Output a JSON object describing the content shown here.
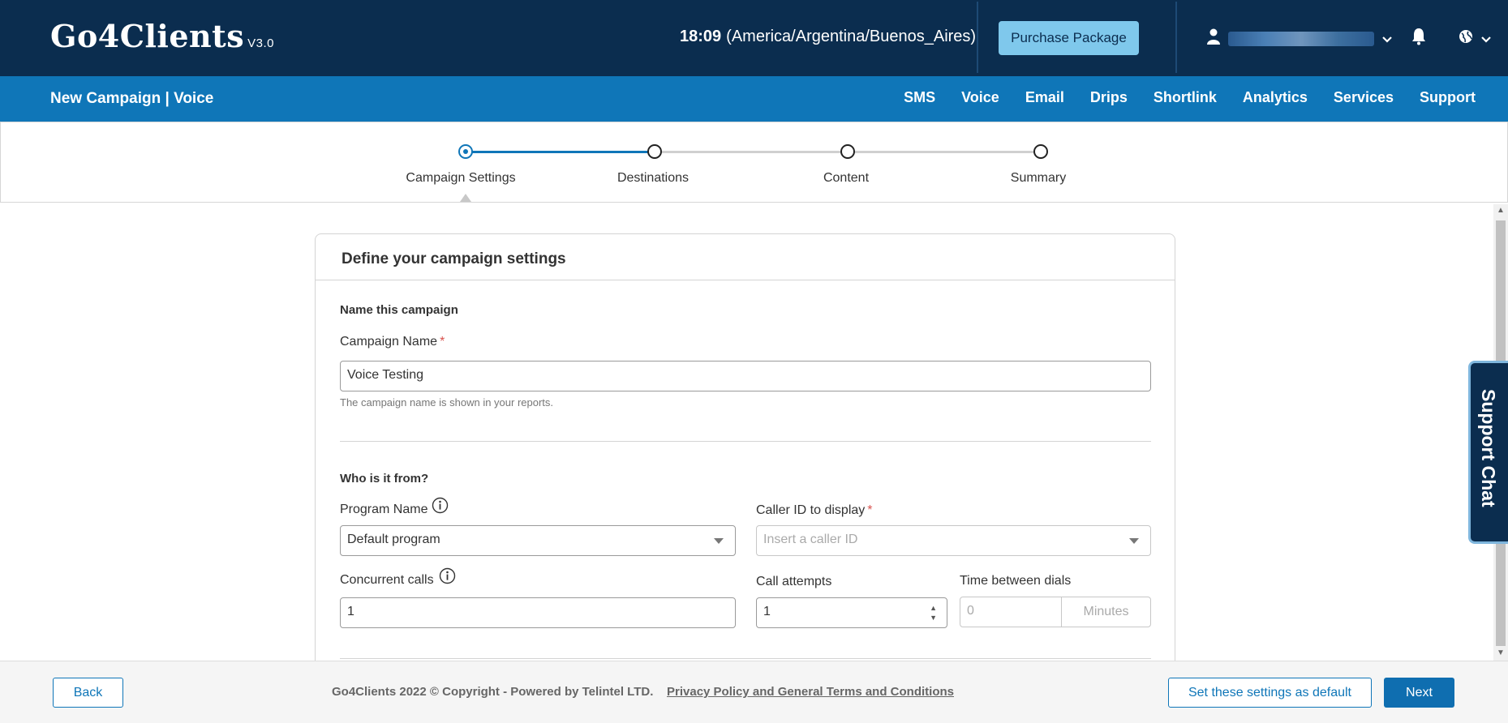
{
  "header": {
    "logo": "Go4Clients",
    "version": "V3.0",
    "time": "18:09",
    "timezone": "(America/Argentina/Buenos_Aires)",
    "purchase_label": "Purchase Package"
  },
  "nav": {
    "page_title": "New Campaign | Voice",
    "items": [
      {
        "label": "SMS"
      },
      {
        "label": "Voice"
      },
      {
        "label": "Email"
      },
      {
        "label": "Drips"
      },
      {
        "label": "Shortlink"
      },
      {
        "label": "Analytics"
      },
      {
        "label": "Services"
      },
      {
        "label": "Support"
      }
    ]
  },
  "stepper": {
    "steps": [
      {
        "label": "Campaign Settings",
        "active": true
      },
      {
        "label": "Destinations",
        "active": false
      },
      {
        "label": "Content",
        "active": false
      },
      {
        "label": "Summary",
        "active": false
      }
    ]
  },
  "form": {
    "card_title": "Define your campaign settings",
    "section_name": "Name this campaign",
    "campaign_name_label": "Campaign Name",
    "campaign_name_value": "Voice Testing",
    "campaign_name_hint": "The campaign name is shown in your reports.",
    "section_from": "Who is it from?",
    "program_name_label": "Program Name",
    "program_name_value": "Default program",
    "caller_id_label": "Caller ID to display",
    "caller_id_placeholder": "Insert a caller ID",
    "concurrent_calls_label": "Concurrent calls",
    "concurrent_calls_value": "1",
    "call_attempts_label": "Call attempts",
    "call_attempts_value": "1",
    "time_between_label": "Time between dials",
    "time_between_placeholder": "0",
    "time_between_unit": "Minutes",
    "required_mark": "*"
  },
  "support_chat": "Support Chat",
  "footer": {
    "back_label": "Back",
    "copyright": "Go4Clients 2022 © Copyright - Powered by Telintel LTD.",
    "policy_link": "Privacy Policy and General Terms and Conditions",
    "default_label": "Set these settings as default",
    "next_label": "Next"
  },
  "colors": {
    "header_bg": "#0b2d4f",
    "nav_bg": "#0f76b8",
    "accent": "#0f76b8",
    "purchase_bg": "#7fc8ec"
  }
}
